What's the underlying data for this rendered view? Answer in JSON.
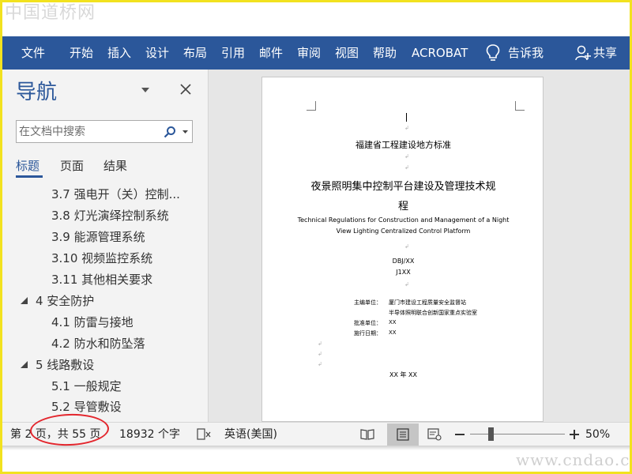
{
  "watermark": {
    "top": "中国道桥网",
    "bottom": "www.cndao.com"
  },
  "ribbon": {
    "tabs": [
      "文件",
      "开始",
      "插入",
      "设计",
      "布局",
      "引用",
      "邮件",
      "审阅",
      "视图",
      "帮助",
      "ACROBAT"
    ],
    "tell_me": "告诉我",
    "share": "共享",
    "bg_color": "#2b579a"
  },
  "nav": {
    "title": "导航",
    "search_placeholder": "在文档中搜索",
    "tabs": [
      "标题",
      "页面",
      "结果"
    ],
    "active_tab": "标题",
    "headings": [
      "3.7 强电开（关）控制...",
      "3.8 灯光演绎控制系统",
      "3.9 能源管理系统",
      "3.10 视频监控系统",
      "3.11 其他相关要求",
      "4 安全防护",
      "4.1 防雷与接地",
      "4.2 防水和防坠落",
      "5 线路敷设",
      "5.1 一般规定",
      "5.2 导管敷设"
    ]
  },
  "document": {
    "standard_line": "福建省工程建设地方标准",
    "title_line1": "夜景照明集中控制平台建设及管理技术规",
    "title_line2": "程",
    "english_line1": "Technical Regulations for Construction and Management of a Night",
    "english_line2": "View Lighting Centralized Control Platform",
    "code1": "DBJ/XX",
    "code2": "J1XX",
    "editor_label": "主编单位：",
    "editor1": "厦门市建设工程质量安全监督站",
    "editor2": "半导体照明联合创新国家重点实验室",
    "approve_label": "批准单位：",
    "approve_value": "XX",
    "date_label": "施行日期：",
    "date_value": "XX",
    "year_line": "XX 年    XX"
  },
  "status": {
    "page": "第 2 页，共 55 页",
    "words": "18932 个字",
    "language": "英语(美国)",
    "zoom": "50%",
    "zoom_percent": 50
  }
}
